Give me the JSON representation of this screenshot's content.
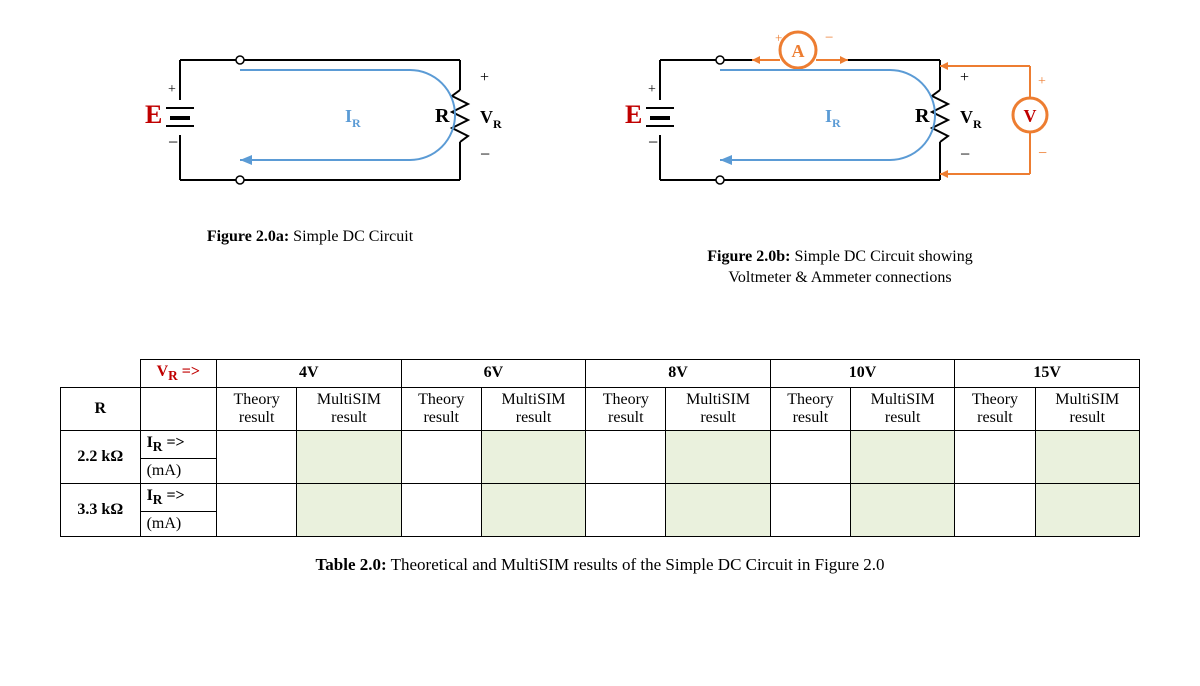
{
  "figures": {
    "a": {
      "caption_label": "Figure 2.0a:",
      "caption_text": " Simple DC Circuit"
    },
    "b": {
      "caption_label": "Figure 2.0b:",
      "caption_text_line1": " Simple DC Circuit showing",
      "caption_text_line2": "Voltmeter & Ammeter connections"
    },
    "labels": {
      "E": "E",
      "IR": "I",
      "IR_sub": "R",
      "R": "R",
      "VR": "V",
      "VR_sub": "R",
      "plus": "+",
      "minus": "−",
      "A": "A",
      "V": "V"
    }
  },
  "table": {
    "vr_arrow_pre": "V",
    "vr_arrow_sub": "R",
    "vr_arrow_post": " =>",
    "R_label": "R",
    "voltage_headers": [
      "4V",
      "6V",
      "8V",
      "10V",
      "15V"
    ],
    "subhead_theory": "Theory",
    "subhead_theory2": "result",
    "subhead_multisim": "MultiSIM",
    "subhead_multisim2": "result",
    "rows": [
      {
        "r_value": "2.2 kΩ",
        "ir_pre": "I",
        "ir_sub": "R",
        "ir_post": " =>",
        "unit": "(mA)"
      },
      {
        "r_value": "3.3 kΩ",
        "ir_pre": "I",
        "ir_sub": "R",
        "ir_post": " =>",
        "unit": "(mA)"
      }
    ],
    "caption_label": "Table 2.0:",
    "caption_text": " Theoretical and MultiSIM results of the Simple DC Circuit in Figure 2.0"
  }
}
